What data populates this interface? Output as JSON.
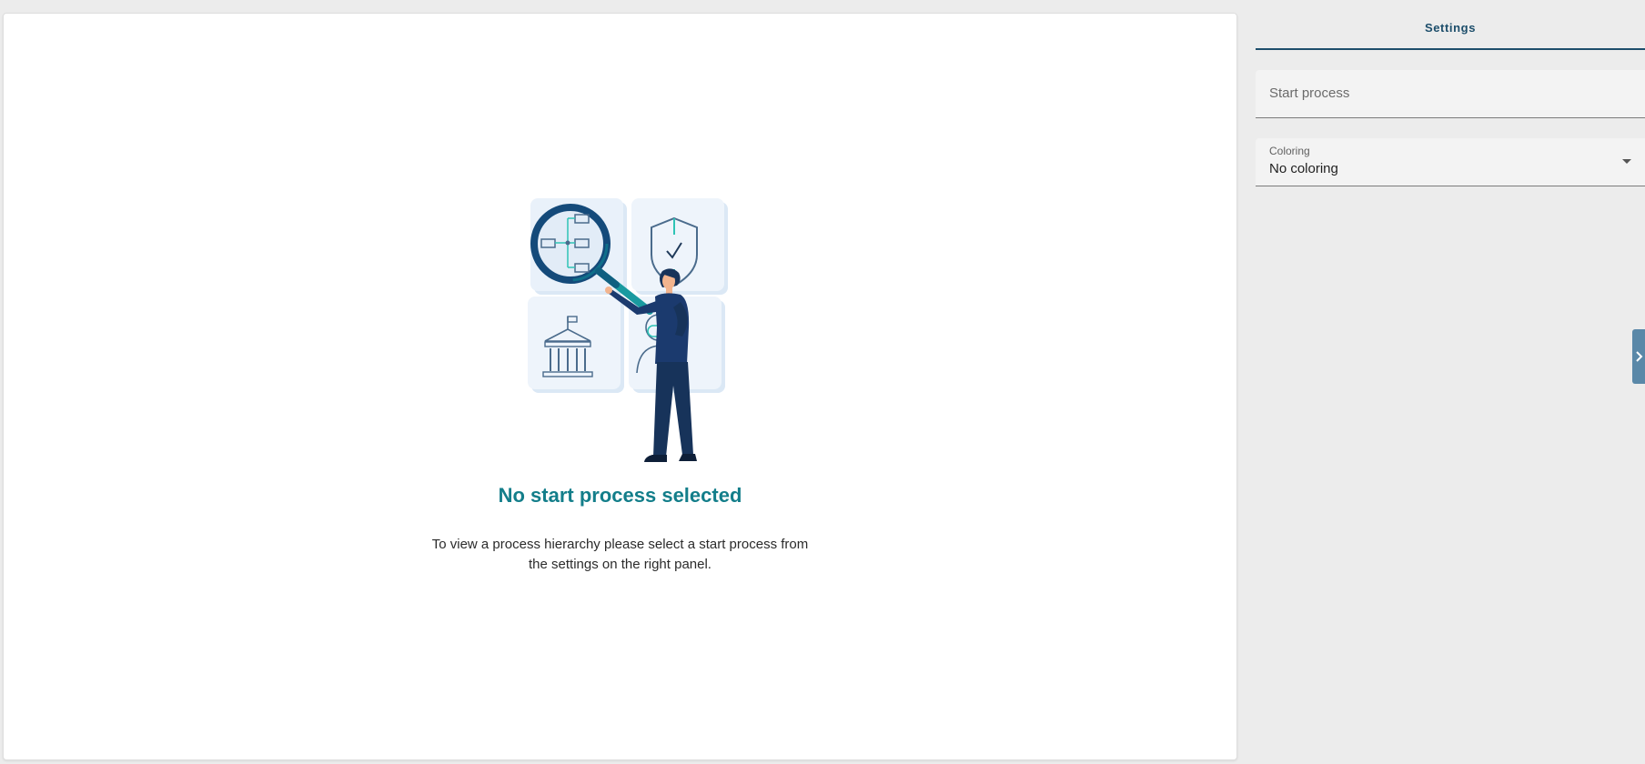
{
  "empty_state": {
    "title": "No start process selected",
    "description": "To view a process hierarchy please select a start process from the settings on the right panel.",
    "illustration": "person-with-magnifier-illustration"
  },
  "settings_panel": {
    "tab_label": "Settings",
    "start_process": {
      "placeholder": "Start process",
      "value": ""
    },
    "coloring": {
      "label": "Coloring",
      "value": "No coloring",
      "icon": "chevron-down-icon"
    },
    "toggle_icon": "chevron-right-icon"
  },
  "colors": {
    "accent_teal": "#137e8a",
    "accent_navy": "#1d4e6b",
    "toggle_blue": "#5a88a8",
    "background": "#ececec"
  }
}
